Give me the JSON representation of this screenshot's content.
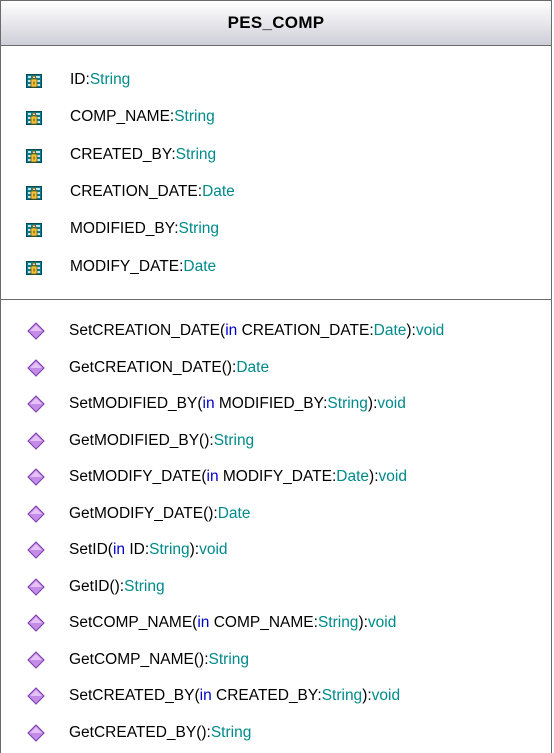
{
  "class_name": "PES_COMP",
  "colors": {
    "type": "#008a8a",
    "keyword": "#0000cc",
    "attribute_icon": "#0a7c92",
    "operation_icon": "#c58be8",
    "border": "#6b6b6b"
  },
  "icons": {
    "attribute": "attribute-icon",
    "operation": "operation-icon"
  },
  "attributes": [
    {
      "name": "ID",
      "sep": ":",
      "type": "String"
    },
    {
      "name": "COMP_NAME",
      "sep": ":",
      "type": "String"
    },
    {
      "name": "CREATED_BY",
      "sep": ":",
      "type": "String"
    },
    {
      "name": "CREATION_DATE",
      "sep": ":",
      "type": "Date"
    },
    {
      "name": "MODIFIED_BY",
      "sep": ":",
      "type": "String"
    },
    {
      "name": "MODIFY_DATE",
      "sep": ":",
      "type": "Date"
    }
  ],
  "operations": [
    {
      "name": "SetCREATION_DATE(",
      "kw": "in",
      "param": " CREATION_DATE:",
      "ptype": "Date",
      "close": "):",
      "ret": "void"
    },
    {
      "name": "GetCREATION_DATE():",
      "kw": "",
      "param": "",
      "ptype": "",
      "close": "",
      "ret": "Date"
    },
    {
      "name": "SetMODIFIED_BY(",
      "kw": "in",
      "param": " MODIFIED_BY:",
      "ptype": "String",
      "close": "):",
      "ret": "void"
    },
    {
      "name": "GetMODIFIED_BY():",
      "kw": "",
      "param": "",
      "ptype": "",
      "close": "",
      "ret": "String"
    },
    {
      "name": "SetMODIFY_DATE(",
      "kw": "in",
      "param": " MODIFY_DATE:",
      "ptype": "Date",
      "close": "):",
      "ret": "void"
    },
    {
      "name": "GetMODIFY_DATE():",
      "kw": "",
      "param": "",
      "ptype": "",
      "close": "",
      "ret": "Date"
    },
    {
      "name": "SetID(",
      "kw": "in",
      "param": " ID:",
      "ptype": "String",
      "close": "):",
      "ret": "void"
    },
    {
      "name": "GetID():",
      "kw": "",
      "param": "",
      "ptype": "",
      "close": "",
      "ret": "String"
    },
    {
      "name": "SetCOMP_NAME(",
      "kw": "in",
      "param": " COMP_NAME:",
      "ptype": "String",
      "close": "):",
      "ret": "void"
    },
    {
      "name": "GetCOMP_NAME():",
      "kw": "",
      "param": "",
      "ptype": "",
      "close": "",
      "ret": "String"
    },
    {
      "name": "SetCREATED_BY(",
      "kw": "in",
      "param": " CREATED_BY:",
      "ptype": "String",
      "close": "):",
      "ret": "void"
    },
    {
      "name": "GetCREATED_BY():",
      "kw": "",
      "param": "",
      "ptype": "",
      "close": "",
      "ret": "String"
    }
  ]
}
